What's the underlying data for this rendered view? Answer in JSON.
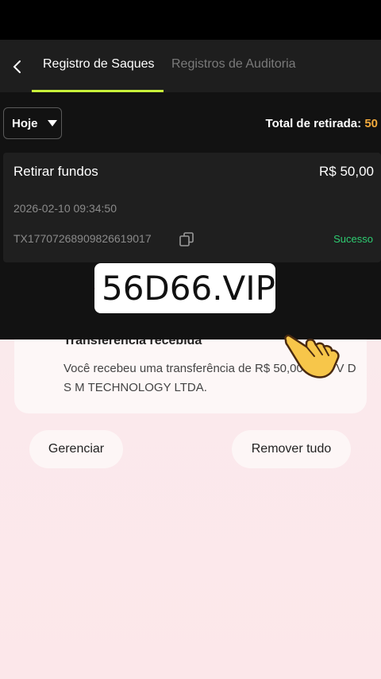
{
  "header": {
    "tabs": [
      {
        "label": "Registro de Saques",
        "active": true
      },
      {
        "label": "Registros de Auditoria",
        "active": false
      }
    ],
    "accent_color": "#c8f03a"
  },
  "filter": {
    "selected": "Hoje",
    "total_label": "Total de retirada:",
    "total_value": "50"
  },
  "record": {
    "title": "Retirar fundos",
    "amount": "R$ 50,00",
    "datetime": "2026-02-10 09:34:50",
    "tx_id": "TX17707268909826619017",
    "status": "Sucesso",
    "status_color": "#2ecc71"
  },
  "watermark": {
    "text": "56D66.VIP",
    "icon": "link-icon"
  },
  "notification": {
    "title": "Transferência recebida",
    "body": "Você recebeu uma transferência de R$ 50,00 de M V D S M TECHNOLOGY LTDA."
  },
  "actions": {
    "manage_label": "Gerenciar",
    "remove_all_label": "Remover tudo"
  }
}
